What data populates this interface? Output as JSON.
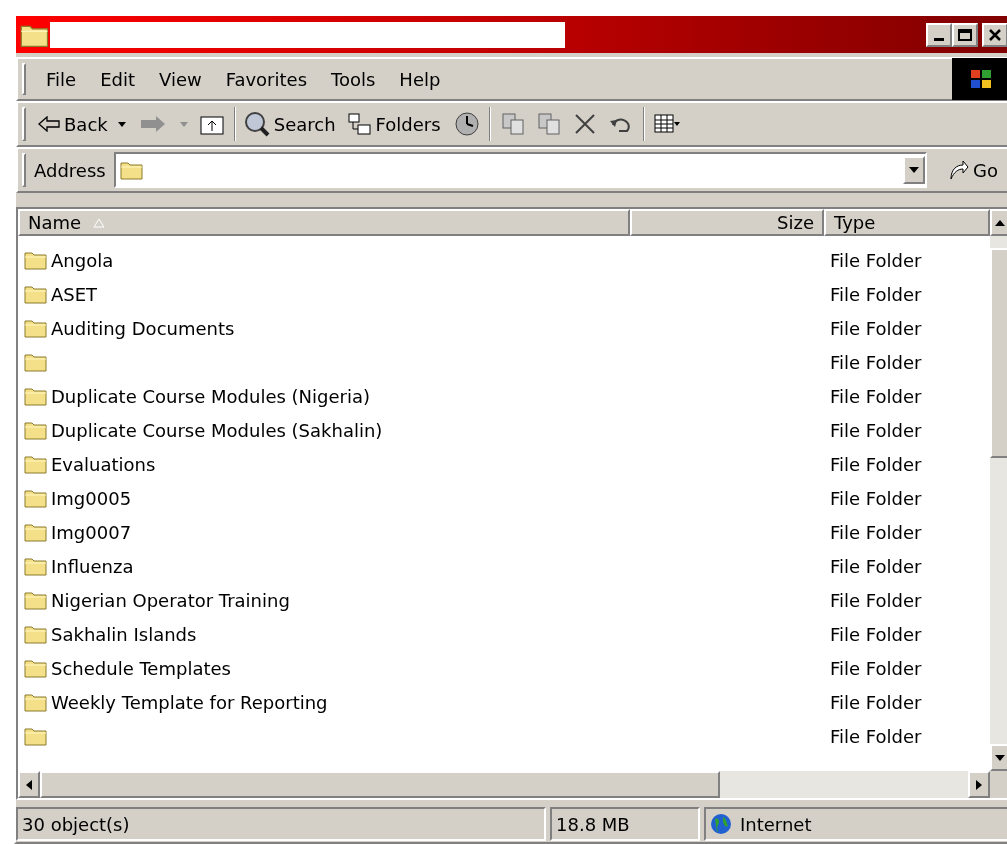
{
  "menu": [
    "File",
    "Edit",
    "View",
    "Favorites",
    "Tools",
    "Help"
  ],
  "toolbar": {
    "back": "Back",
    "search": "Search",
    "folders": "Folders"
  },
  "address": {
    "label": "Address",
    "go": "Go"
  },
  "columns": [
    "Name",
    "Size",
    "Type"
  ],
  "rows": [
    {
      "name": "Angola",
      "type": "File Folder"
    },
    {
      "name": "ASET",
      "type": "File Folder"
    },
    {
      "name": "Auditing Documents",
      "type": "File Folder"
    },
    {
      "type": "File Folder"
    },
    {
      "name": "Duplicate Course Modules (Nigeria)",
      "type": "File Folder"
    },
    {
      "name": "Duplicate Course Modules (Sakhalin)",
      "type": "File Folder"
    },
    {
      "name": "Evaluations",
      "type": "File Folder"
    },
    {
      "name": "Img0005",
      "type": "File Folder"
    },
    {
      "name": "Img0007",
      "type": "File Folder"
    },
    {
      "name": "Influenza",
      "type": "File Folder"
    },
    {
      "name": "Nigerian Operator Training",
      "type": "File Folder"
    },
    {
      "name": "Sakhalin Islands",
      "type": "File Folder"
    },
    {
      "name": "Schedule Templates",
      "type": "File Folder"
    },
    {
      "name": "Weekly Template for Reporting",
      "type": "File Folder"
    },
    {
      "type": "File Folder"
    }
  ],
  "status_bar": {
    "objects": "30 object(s)",
    "size": "18.8 MB",
    "zone": "Internet"
  }
}
